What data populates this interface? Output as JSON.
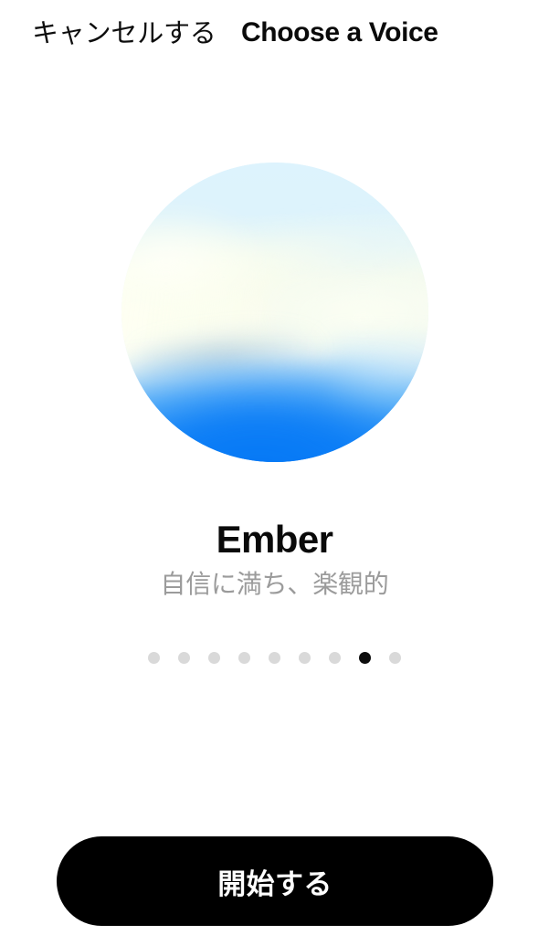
{
  "header": {
    "cancel_label": "キャンセルする",
    "title": "Choose a Voice"
  },
  "voice": {
    "name": "Ember",
    "description": "自信に満ち、楽観的",
    "orb_icon": "voice-orb",
    "colors": {
      "orb_top": "#ddf3fd",
      "orb_mid": "#fbfdf0",
      "orb_bottom": "#0b7cf5"
    }
  },
  "pager": {
    "total": 9,
    "active_index": 7,
    "dots": [
      {
        "label": "1"
      },
      {
        "label": "2"
      },
      {
        "label": "3"
      },
      {
        "label": "4"
      },
      {
        "label": "5"
      },
      {
        "label": "6"
      },
      {
        "label": "7"
      },
      {
        "label": "8"
      },
      {
        "label": "9"
      }
    ],
    "colors": {
      "inactive": "#d9d9d9",
      "active": "#0d0d0d"
    }
  },
  "cta": {
    "label": "開始する",
    "background": "#000000",
    "text_color": "#ffffff"
  }
}
